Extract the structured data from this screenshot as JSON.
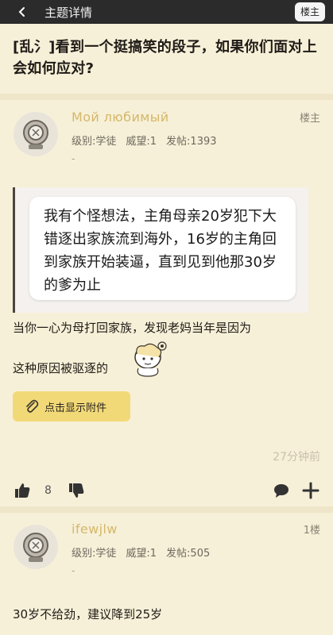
{
  "header": {
    "title": "主题详情",
    "op_button": "楼主"
  },
  "thread": {
    "title": "[乱氵]看到一个挺搞笑的段子，如果你们面对上会如何应对?"
  },
  "posts": [
    {
      "username": "Мой любимый",
      "level_label": "级别:学徒",
      "reputation": "威望:1",
      "post_count": "发帖:1393",
      "signature": "-",
      "floor": "楼主",
      "image_text": "我有个怪想法，主角母亲20岁犯下大错逐出家族流到海外，16岁的主角回到家族开始装逼，直到见到他那30岁的爹为止",
      "text_line1": "当你一心为母打回家族，发现老妈当年是因为",
      "text_line2": "这种原因被驱逐的",
      "attachment_label": "点击显示附件",
      "time": "27分钟前",
      "likes": "8"
    },
    {
      "username": "ifewjlw",
      "level_label": "级别:学徒",
      "reputation": "威望:1",
      "post_count": "发帖:505",
      "signature": "-",
      "floor": "1楼",
      "text": "30岁不给劲，建议降到25岁"
    }
  ],
  "colors": {
    "accent": "#f2d978",
    "username": "#d4b86a",
    "background": "#f7f0d8",
    "topbar": "#2b2b2b"
  }
}
